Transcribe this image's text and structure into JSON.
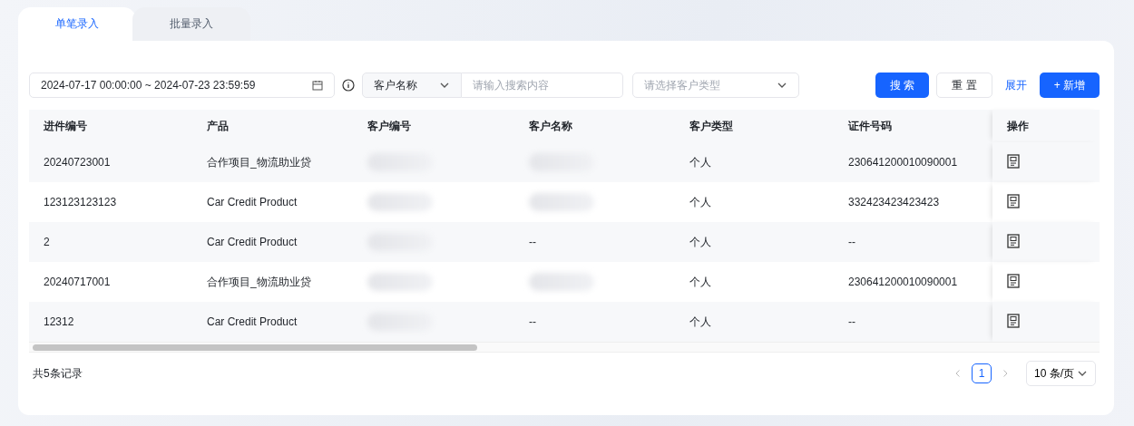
{
  "tabs": [
    {
      "label": "单笔录入",
      "selected": true
    },
    {
      "label": "批量录入",
      "selected": false
    }
  ],
  "filters": {
    "date_range": "2024-07-17 00:00:00 ~ 2024-07-23 23:59:59",
    "field_select": "客户名称",
    "search": {
      "placeholder": "请输入搜索内容"
    },
    "type_select": {
      "placeholder": "请选择客户类型"
    }
  },
  "actions": {
    "search": "搜 索",
    "reset": "重 置",
    "expand": "展开",
    "add": "+ 新增"
  },
  "table": {
    "columns": [
      "进件编号",
      "产品",
      "客户编号",
      "客户名称",
      "客户类型",
      "证件号码",
      "操作"
    ],
    "rows": [
      {
        "cells": [
          "20240723001",
          "合作项目_物流助业贷",
          null,
          null,
          "个人",
          "230641200010090001"
        ]
      },
      {
        "cells": [
          "123123123123",
          "Car Credit Product",
          null,
          null,
          "个人",
          "332423423423423"
        ]
      },
      {
        "cells": [
          "2",
          "Car Credit Product",
          null,
          "--",
          "个人",
          "--"
        ]
      },
      {
        "cells": [
          "20240717001",
          "合作项目_物流助业贷",
          null,
          null,
          "个人",
          "230641200010090001"
        ]
      },
      {
        "cells": [
          "12312",
          "Car Credit Product",
          null,
          "--",
          "个人",
          "--"
        ]
      }
    ]
  },
  "footer": {
    "total": "共5条记录",
    "pages": [
      {
        "label": "1",
        "selected": true
      }
    ],
    "page_size": "10 条/页"
  }
}
